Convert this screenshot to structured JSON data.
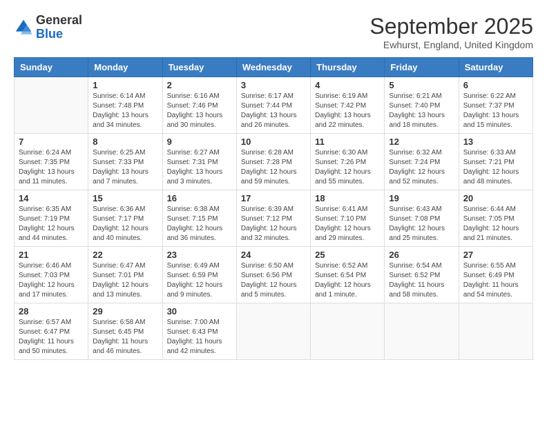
{
  "logo": {
    "general": "General",
    "blue": "Blue"
  },
  "header": {
    "month": "September 2025",
    "location": "Ewhurst, England, United Kingdom"
  },
  "days_of_week": [
    "Sunday",
    "Monday",
    "Tuesday",
    "Wednesday",
    "Thursday",
    "Friday",
    "Saturday"
  ],
  "weeks": [
    [
      {
        "day": "",
        "sunrise": "",
        "sunset": "",
        "daylight": ""
      },
      {
        "day": "1",
        "sunrise": "Sunrise: 6:14 AM",
        "sunset": "Sunset: 7:48 PM",
        "daylight": "Daylight: 13 hours and 34 minutes."
      },
      {
        "day": "2",
        "sunrise": "Sunrise: 6:16 AM",
        "sunset": "Sunset: 7:46 PM",
        "daylight": "Daylight: 13 hours and 30 minutes."
      },
      {
        "day": "3",
        "sunrise": "Sunrise: 6:17 AM",
        "sunset": "Sunset: 7:44 PM",
        "daylight": "Daylight: 13 hours and 26 minutes."
      },
      {
        "day": "4",
        "sunrise": "Sunrise: 6:19 AM",
        "sunset": "Sunset: 7:42 PM",
        "daylight": "Daylight: 13 hours and 22 minutes."
      },
      {
        "day": "5",
        "sunrise": "Sunrise: 6:21 AM",
        "sunset": "Sunset: 7:40 PM",
        "daylight": "Daylight: 13 hours and 18 minutes."
      },
      {
        "day": "6",
        "sunrise": "Sunrise: 6:22 AM",
        "sunset": "Sunset: 7:37 PM",
        "daylight": "Daylight: 13 hours and 15 minutes."
      }
    ],
    [
      {
        "day": "7",
        "sunrise": "Sunrise: 6:24 AM",
        "sunset": "Sunset: 7:35 PM",
        "daylight": "Daylight: 13 hours and 11 minutes."
      },
      {
        "day": "8",
        "sunrise": "Sunrise: 6:25 AM",
        "sunset": "Sunset: 7:33 PM",
        "daylight": "Daylight: 13 hours and 7 minutes."
      },
      {
        "day": "9",
        "sunrise": "Sunrise: 6:27 AM",
        "sunset": "Sunset: 7:31 PM",
        "daylight": "Daylight: 13 hours and 3 minutes."
      },
      {
        "day": "10",
        "sunrise": "Sunrise: 6:28 AM",
        "sunset": "Sunset: 7:28 PM",
        "daylight": "Daylight: 12 hours and 59 minutes."
      },
      {
        "day": "11",
        "sunrise": "Sunrise: 6:30 AM",
        "sunset": "Sunset: 7:26 PM",
        "daylight": "Daylight: 12 hours and 55 minutes."
      },
      {
        "day": "12",
        "sunrise": "Sunrise: 6:32 AM",
        "sunset": "Sunset: 7:24 PM",
        "daylight": "Daylight: 12 hours and 52 minutes."
      },
      {
        "day": "13",
        "sunrise": "Sunrise: 6:33 AM",
        "sunset": "Sunset: 7:21 PM",
        "daylight": "Daylight: 12 hours and 48 minutes."
      }
    ],
    [
      {
        "day": "14",
        "sunrise": "Sunrise: 6:35 AM",
        "sunset": "Sunset: 7:19 PM",
        "daylight": "Daylight: 12 hours and 44 minutes."
      },
      {
        "day": "15",
        "sunrise": "Sunrise: 6:36 AM",
        "sunset": "Sunset: 7:17 PM",
        "daylight": "Daylight: 12 hours and 40 minutes."
      },
      {
        "day": "16",
        "sunrise": "Sunrise: 6:38 AM",
        "sunset": "Sunset: 7:15 PM",
        "daylight": "Daylight: 12 hours and 36 minutes."
      },
      {
        "day": "17",
        "sunrise": "Sunrise: 6:39 AM",
        "sunset": "Sunset: 7:12 PM",
        "daylight": "Daylight: 12 hours and 32 minutes."
      },
      {
        "day": "18",
        "sunrise": "Sunrise: 6:41 AM",
        "sunset": "Sunset: 7:10 PM",
        "daylight": "Daylight: 12 hours and 29 minutes."
      },
      {
        "day": "19",
        "sunrise": "Sunrise: 6:43 AM",
        "sunset": "Sunset: 7:08 PM",
        "daylight": "Daylight: 12 hours and 25 minutes."
      },
      {
        "day": "20",
        "sunrise": "Sunrise: 6:44 AM",
        "sunset": "Sunset: 7:05 PM",
        "daylight": "Daylight: 12 hours and 21 minutes."
      }
    ],
    [
      {
        "day": "21",
        "sunrise": "Sunrise: 6:46 AM",
        "sunset": "Sunset: 7:03 PM",
        "daylight": "Daylight: 12 hours and 17 minutes."
      },
      {
        "day": "22",
        "sunrise": "Sunrise: 6:47 AM",
        "sunset": "Sunset: 7:01 PM",
        "daylight": "Daylight: 12 hours and 13 minutes."
      },
      {
        "day": "23",
        "sunrise": "Sunrise: 6:49 AM",
        "sunset": "Sunset: 6:59 PM",
        "daylight": "Daylight: 12 hours and 9 minutes."
      },
      {
        "day": "24",
        "sunrise": "Sunrise: 6:50 AM",
        "sunset": "Sunset: 6:56 PM",
        "daylight": "Daylight: 12 hours and 5 minutes."
      },
      {
        "day": "25",
        "sunrise": "Sunrise: 6:52 AM",
        "sunset": "Sunset: 6:54 PM",
        "daylight": "Daylight: 12 hours and 1 minute."
      },
      {
        "day": "26",
        "sunrise": "Sunrise: 6:54 AM",
        "sunset": "Sunset: 6:52 PM",
        "daylight": "Daylight: 11 hours and 58 minutes."
      },
      {
        "day": "27",
        "sunrise": "Sunrise: 6:55 AM",
        "sunset": "Sunset: 6:49 PM",
        "daylight": "Daylight: 11 hours and 54 minutes."
      }
    ],
    [
      {
        "day": "28",
        "sunrise": "Sunrise: 6:57 AM",
        "sunset": "Sunset: 6:47 PM",
        "daylight": "Daylight: 11 hours and 50 minutes."
      },
      {
        "day": "29",
        "sunrise": "Sunrise: 6:58 AM",
        "sunset": "Sunset: 6:45 PM",
        "daylight": "Daylight: 11 hours and 46 minutes."
      },
      {
        "day": "30",
        "sunrise": "Sunrise: 7:00 AM",
        "sunset": "Sunset: 6:43 PM",
        "daylight": "Daylight: 11 hours and 42 minutes."
      },
      {
        "day": "",
        "sunrise": "",
        "sunset": "",
        "daylight": ""
      },
      {
        "day": "",
        "sunrise": "",
        "sunset": "",
        "daylight": ""
      },
      {
        "day": "",
        "sunrise": "",
        "sunset": "",
        "daylight": ""
      },
      {
        "day": "",
        "sunrise": "",
        "sunset": "",
        "daylight": ""
      }
    ]
  ]
}
